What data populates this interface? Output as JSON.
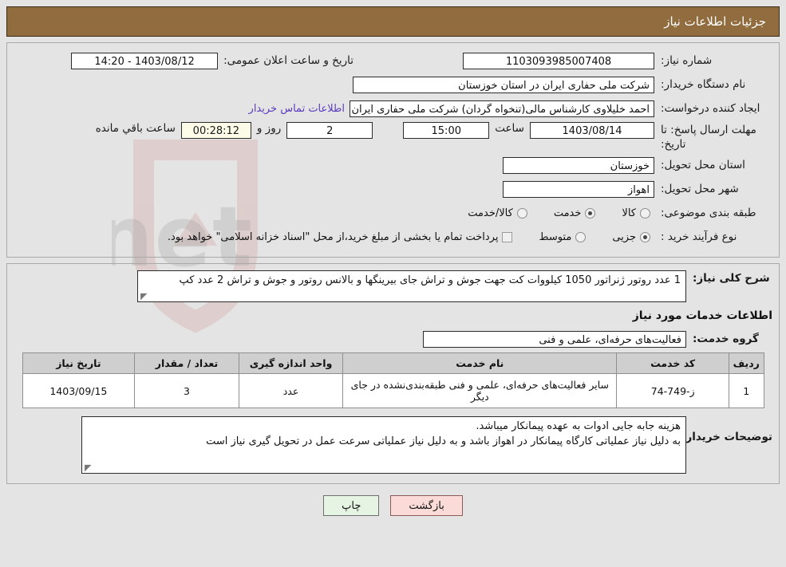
{
  "header": {
    "title": "جزئیات اطلاعات نیاز"
  },
  "form": {
    "need_number_label": "شماره نیاز:",
    "need_number_value": "1103093985007408",
    "public_announce_label": "تاریخ و ساعت اعلان عمومی:",
    "public_announce_value": "1403/08/12 - 14:20",
    "buyer_org_label": "نام دستگاه خریدار:",
    "buyer_org_value": "شرکت ملی حفاری ایران در استان خوزستان",
    "creator_label": "ایجاد کننده درخواست:",
    "creator_value": "احمد خلیلاوی کارشناس مالی(تنخواه گردان) شرکت ملی حفاری ایران در استان",
    "contact_link": "اطلاعات تماس خریدار",
    "deadline_label": "مهلت ارسال پاسخ: تا تاریخ:",
    "deadline_date": "1403/08/14",
    "hour_label": "ساعت",
    "hour_value": "15:00",
    "days_value": "2",
    "days_and_label": "روز و",
    "countdown_value": "00:28:12",
    "countdown_suffix": "ساعت باقي مانده",
    "province_label": "استان محل تحویل:",
    "province_value": "خوزستان",
    "city_label": "شهر محل تحویل:",
    "city_value": "اهواز",
    "category_label": "طبقه بندی موضوعی:",
    "category_options": [
      {
        "label": "کالا",
        "selected": false
      },
      {
        "label": "خدمت",
        "selected": true
      },
      {
        "label": "کالا/خدمت",
        "selected": false
      }
    ],
    "process_label": "نوع فرآیند خرید :",
    "process_options": [
      {
        "label": "جزیی",
        "selected": true
      },
      {
        "label": "متوسط",
        "selected": false
      }
    ],
    "treasury_checkbox_text": "پرداخت تمام یا بخشی از مبلغ خرید،از محل \"اسناد خزانه اسلامی\" خواهد بود.",
    "treasury_checked": false
  },
  "description": {
    "label": "شرح کلی نیاز:",
    "value": "1 عدد روتور ژنراتور 1050 کیلووات کت جهت جوش و تراش جای بیرینگها و بالانس روتور و جوش و تراش 2 عدد کپ"
  },
  "services": {
    "section_title": "اطلاعات خدمات مورد نیاز",
    "group_label": "گروه خدمت:",
    "group_value": "فعالیت‌های حرفه‌ای، علمی و فنی",
    "table": {
      "headers": [
        "ردیف",
        "کد خدمت",
        "نام خدمت",
        "واحد اندازه گیری",
        "تعداد / مقدار",
        "تاریخ نیاز"
      ],
      "rows": [
        {
          "radif": "1",
          "code": "ز-749-74",
          "name": "سایر فعالیت‌های حرفه‌ای، علمی و فنی طبقه‌بندی‌نشده در جای دیگر",
          "unit": "عدد",
          "qty": "3",
          "date": "1403/09/15"
        }
      ]
    }
  },
  "notes": {
    "label": "توضیحات خریدار:",
    "line1": "هزینه جابه جایی ادوات به عهده پیمانکار میباشد.",
    "line2": "به دلیل نیاز عملیاتی کارگاه پیمانکار در اهواز باشد و به دلیل نیاز عملیاتی سرعت عمل در تحویل گیری نیاز است"
  },
  "buttons": {
    "print": "چاپ",
    "back": "بازگشت"
  },
  "colors": {
    "header_bg": "#916c3e",
    "page_bg": "#e4e4e4",
    "link": "#5b3bbf",
    "countdown_bg": "#fbfbe8",
    "print_bg": "#e6f4e3",
    "back_bg": "#fadbd8"
  }
}
